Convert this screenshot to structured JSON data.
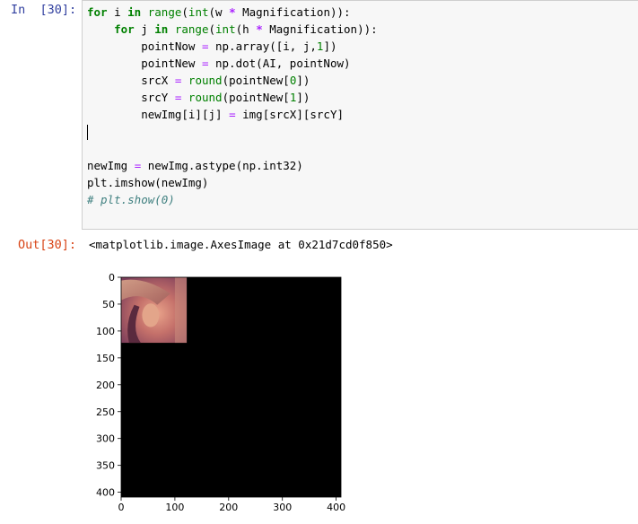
{
  "cell": {
    "input_prompt": "In  [30]:",
    "output_prompt": "Out[30]:",
    "output_text": "<matplotlib.image.AxesImage at 0x21d7cd0f850>"
  },
  "code": {
    "line1": {
      "kw_for": "for",
      "var": " i ",
      "kw_in": "in",
      "sp": " ",
      "fn_range": "range",
      "p1": "(",
      "fn_int": "int",
      "p2": "(w ",
      "op_mul": "*",
      "rest": " Magnification)):"
    },
    "line2": {
      "indent": "    ",
      "kw_for": "for",
      "var": " j ",
      "kw_in": "in",
      "sp": " ",
      "fn_range": "range",
      "p1": "(",
      "fn_int": "int",
      "p2": "(h ",
      "op_mul": "*",
      "rest": " Magnification)):"
    },
    "line3": {
      "indent": "        ",
      "lhs": "pointNow ",
      "eq": "=",
      "mid": " np.array([i, j,",
      "num": "1",
      "end": "])"
    },
    "line4": {
      "indent": "        ",
      "lhs": "pointNew ",
      "eq": "=",
      "rhs": " np.dot(AI, pointNow)"
    },
    "line5": {
      "indent": "        ",
      "lhs": "srcX ",
      "eq": "=",
      "sp": " ",
      "fn": "round",
      "mid": "(pointNew[",
      "num": "0",
      "end": "])"
    },
    "line6": {
      "indent": "        ",
      "lhs": "srcY ",
      "eq": "=",
      "sp": " ",
      "fn": "round",
      "mid": "(pointNew[",
      "num": "1",
      "end": "])"
    },
    "line7": {
      "indent": "        ",
      "lhs": "newImg[i][j] ",
      "eq": "=",
      "rhs": " img[srcX][srcY]"
    },
    "line10": {
      "lhs": "newImg ",
      "eq": "=",
      "rhs": " newImg.astype(np.int32)"
    },
    "line11": {
      "text": "plt.imshow(newImg)"
    },
    "line12": {
      "comment": "# plt.show(0)"
    }
  },
  "chart_data": {
    "type": "image",
    "description_free": true,
    "x_ticks": [
      "0",
      "100",
      "200",
      "300",
      "400"
    ],
    "y_ticks": [
      "0",
      "50",
      "100",
      "150",
      "200",
      "250",
      "300",
      "350",
      "400"
    ],
    "xlim": [
      0,
      409
    ],
    "ylim": [
      409,
      0
    ],
    "image_extent": [
      0,
      409,
      0,
      409
    ],
    "inset_extent": [
      0,
      122,
      0,
      122
    ],
    "background_color": "#000000"
  }
}
